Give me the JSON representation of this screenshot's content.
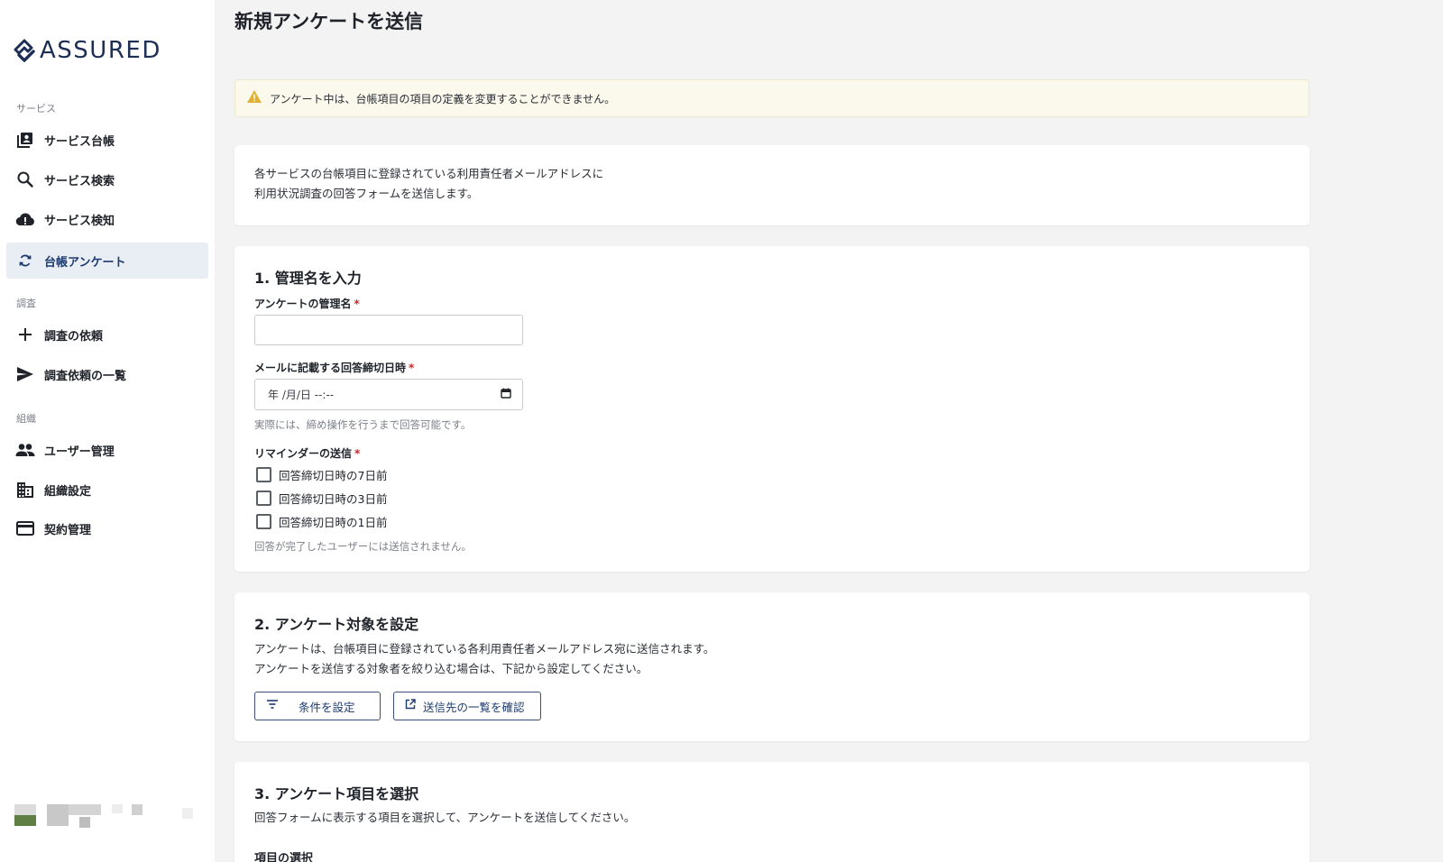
{
  "brand": {
    "name": "ASSURED"
  },
  "sidebar": {
    "sections": [
      {
        "label": "サービス"
      },
      {
        "label": "調査"
      },
      {
        "label": "組織"
      }
    ],
    "items": [
      {
        "label": "サービス台帳",
        "icon": "library-icon"
      },
      {
        "label": "サービス検索",
        "icon": "search-icon"
      },
      {
        "label": "サービス検知",
        "icon": "cloud-alert-icon"
      },
      {
        "label": "台帳アンケート",
        "icon": "sync-icon",
        "active": true
      },
      {
        "label": "調査の依頼",
        "icon": "plus-icon"
      },
      {
        "label": "調査依頼の一覧",
        "icon": "send-icon"
      },
      {
        "label": "ユーザー管理",
        "icon": "people-icon"
      },
      {
        "label": "組織設定",
        "icon": "building-icon"
      },
      {
        "label": "契約管理",
        "icon": "credit-card-icon"
      }
    ]
  },
  "page": {
    "title": "新規アンケートを送信",
    "alert": "アンケート中は、台帳項目の項目の定義を変更することができません。",
    "intro": {
      "line1": "各サービスの台帳項目に登録されている利用責任者メールアドレスに",
      "line2": "利用状況調査の回答フォームを送信します。"
    },
    "section1": {
      "title": "1. 管理名を入力",
      "name_label": "アンケートの管理名",
      "name_value": "",
      "deadline_label": "メールに記載する回答締切日時",
      "deadline_value": "年 /月/日 --:--",
      "deadline_help": "実際には、締め操作を行うまで回答可能です。",
      "reminder_label": "リマインダーの送信",
      "required_mark": "*",
      "reminders": [
        {
          "label": "回答締切日時の7日前",
          "checked": false
        },
        {
          "label": "回答締切日時の3日前",
          "checked": false
        },
        {
          "label": "回答締切日時の1日前",
          "checked": false
        }
      ],
      "reminder_help": "回答が完了したユーザーには送信されません。"
    },
    "section2": {
      "title": "2. アンケート対象を設定",
      "desc1": "アンケートは、台帳項目に登録されている各利用責任者メールアドレス宛に送信されます。",
      "desc2": "アンケートを送信する対象者を絞り込む場合は、下記から設定してください。",
      "filter_button": "条件を設定",
      "recipients_button": "送信先の一覧を確認"
    },
    "section3": {
      "title": "3. アンケート項目を選択",
      "desc": "回答フォームに表示する項目を選択して、アンケートを送信してください。",
      "sub_label": "項目の選択"
    }
  },
  "colors": {
    "brand": "#1d2f55",
    "active_bg": "#e9edf4",
    "alert_bg": "#fbf8ec",
    "warning": "#e0b233",
    "required": "#c62828",
    "button_border": "#3b4f78"
  }
}
